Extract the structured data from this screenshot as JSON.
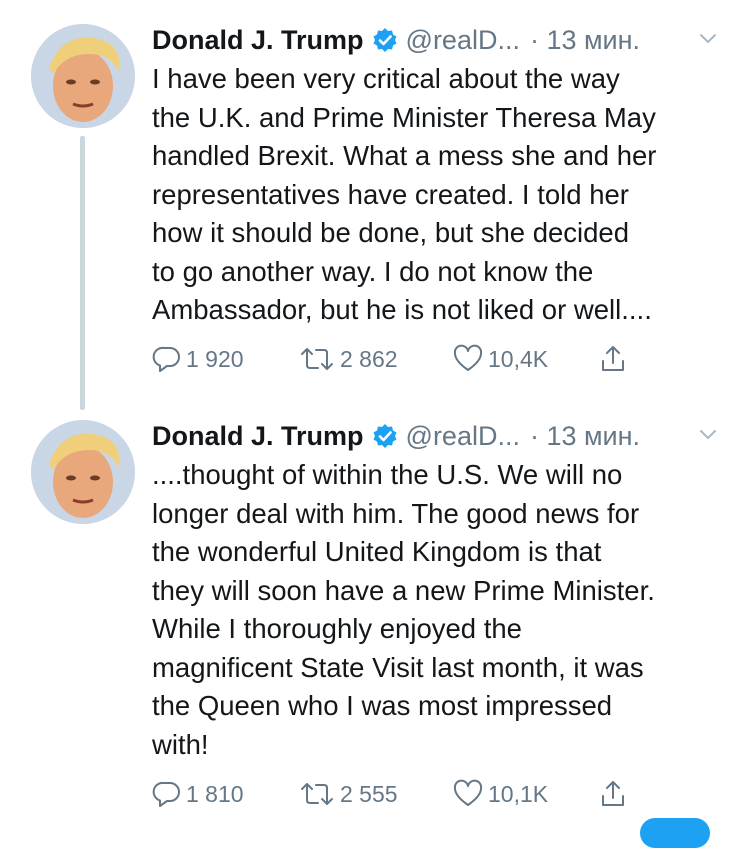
{
  "tweets": [
    {
      "display_name": "Donald J. Trump",
      "handle": "@realD...",
      "time": "· 13 мин.",
      "text": "I have been very critical about the way\nthe U.K. and Prime Minister Theresa May\nhandled Brexit. What a mess she and her\nrepresentatives have created. I told her\nhow it should be done, but she decided\nto go another way. I do not know the\nAmbassador, but he is not liked or well....",
      "replies": "1 920",
      "retweets": "2 862",
      "likes": "10,4K"
    },
    {
      "display_name": "Donald J. Trump",
      "handle": "@realD...",
      "time": "· 13 мин.",
      "text": "....thought of within the U.S. We will no\nlonger deal with him. The good news for\nthe wonderful United Kingdom is that\nthey will soon have a new Prime Minister.\nWhile I thoroughly enjoyed the\nmagnificent State Visit last month, it was\nthe Queen who I was most impressed\nwith!",
      "replies": "1 810",
      "retweets": "2 555",
      "likes": "10,1K"
    }
  ],
  "icons": {
    "verified": "verified-badge-icon",
    "caret": "chevron-down-icon",
    "reply": "reply-icon",
    "retweet": "retweet-icon",
    "like": "heart-icon",
    "share": "share-icon"
  },
  "colors": {
    "text": "#14171a",
    "secondary": "#657786",
    "verified": "#1da1f2",
    "thread_line": "#ccd6dd"
  }
}
